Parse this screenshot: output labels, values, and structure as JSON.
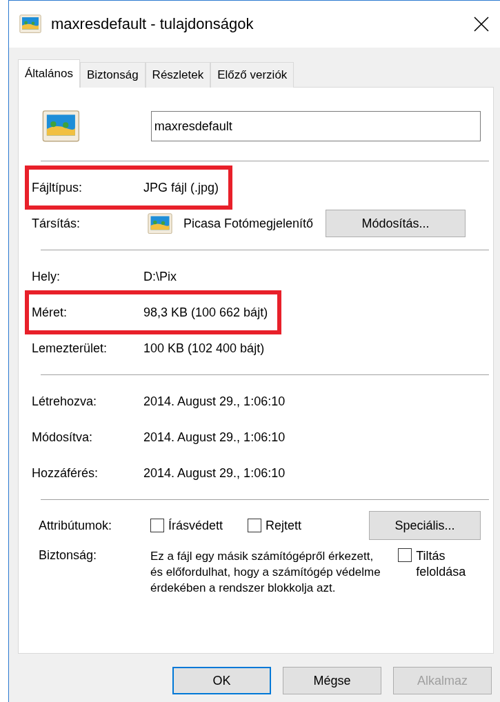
{
  "window": {
    "title": "maxresdefault - tulajdonságok"
  },
  "tabs": [
    {
      "label": "Általános",
      "selected": true
    },
    {
      "label": "Biztonság",
      "selected": false
    },
    {
      "label": "Részletek",
      "selected": false
    },
    {
      "label": "Előző verziók",
      "selected": false
    }
  ],
  "file_name": {
    "value": "maxresdefault"
  },
  "sections": [
    [
      {
        "kind": "text",
        "label": "Fájltípus:",
        "value": "JPG fájl (.jpg)",
        "highlighted": true
      },
      {
        "kind": "app",
        "label": "Társítás:",
        "value": "Picasa Fotómegjelenítő",
        "button": "Módosítás...",
        "highlighted": false
      }
    ],
    [
      {
        "kind": "text",
        "label": "Hely:",
        "value": "D:\\Pix",
        "highlighted": false
      },
      {
        "kind": "text",
        "label": "Méret:",
        "value": "98,3 KB (100 662 bájt)",
        "highlighted": true
      },
      {
        "kind": "text",
        "label": "Lemezterület:",
        "value": "100 KB (102 400 bájt)",
        "highlighted": false
      }
    ],
    [
      {
        "kind": "text",
        "label": "Létrehozva:",
        "value": "2014. August 29., 1:06:10",
        "highlighted": false
      },
      {
        "kind": "text",
        "label": "Módosítva:",
        "value": "2014. August 29., 1:06:10",
        "highlighted": false
      },
      {
        "kind": "text",
        "label": "Hozzáférés:",
        "value": "2014. August 29., 1:06:10",
        "highlighted": false
      }
    ]
  ],
  "attributes": {
    "label": "Attribútumok:",
    "checkboxes": [
      {
        "label": "Írásvédett",
        "checked": false
      },
      {
        "label": "Rejtett",
        "checked": false
      }
    ],
    "button": "Speciális..."
  },
  "security": {
    "label": "Biztonság:",
    "text": "Ez a fájl egy másik számítógépről érkezett, és előfordulhat, hogy a számítógép védelme érdekében a rendszer blokkolja azt.",
    "checkbox": {
      "label": "Tiltás feloldása",
      "checked": false
    }
  },
  "buttons": [
    {
      "label": "OK",
      "default": true,
      "disabled": false
    },
    {
      "label": "Mégse",
      "default": false,
      "disabled": false
    },
    {
      "label": "Alkalmaz",
      "default": false,
      "disabled": true
    }
  ]
}
